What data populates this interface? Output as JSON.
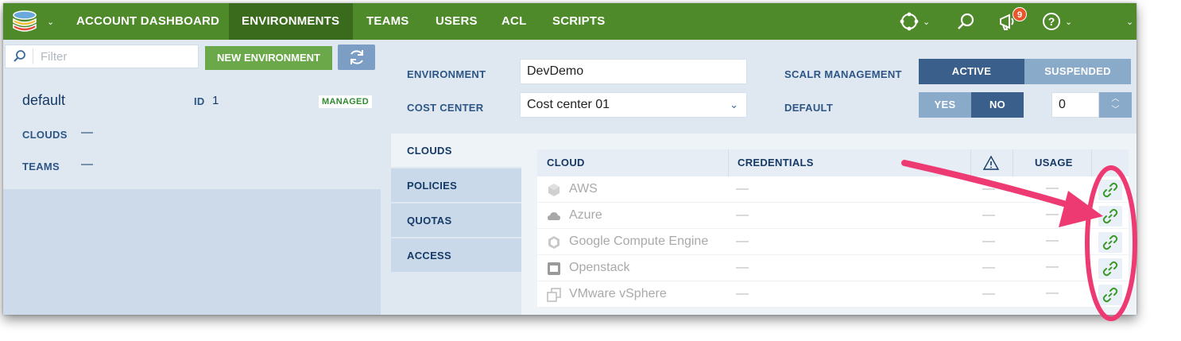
{
  "nav": {
    "items": [
      "ACCOUNT DASHBOARD",
      "ENVIRONMENTS",
      "TEAMS",
      "USERS",
      "ACL",
      "SCRIPTS"
    ],
    "active": "ENVIRONMENTS",
    "notification_count": "9",
    "colors": {
      "bar": "#4e8a2a",
      "active": "#3a6b1c",
      "badge": "#e8562a"
    }
  },
  "sidebar": {
    "filter_placeholder": "Filter",
    "new_button": "NEW ENVIRONMENT",
    "environment": {
      "name": "default",
      "id_label": "ID",
      "id_value": "1",
      "badge": "MANAGED",
      "clouds_label": "CLOUDS",
      "clouds_value": "—",
      "teams_label": "TEAMS",
      "teams_value": "—"
    }
  },
  "form": {
    "environment_label": "ENVIRONMENT",
    "environment_value": "DevDemo",
    "cost_center_label": "COST CENTER",
    "cost_center_value": "Cost center 01",
    "scalr_management_label": "SCALR MANAGEMENT",
    "management_options": [
      "ACTIVE",
      "SUSPENDED"
    ],
    "management_selected": "ACTIVE",
    "default_label": "DEFAULT",
    "default_options": [
      "YES",
      "NO"
    ],
    "default_selected": "NO",
    "default_number": "0"
  },
  "tabs": [
    "CLOUDS",
    "POLICIES",
    "QUOTAS",
    "ACCESS"
  ],
  "active_tab": "CLOUDS",
  "table": {
    "headers": {
      "cloud": "CLOUD",
      "credentials": "CREDENTIALS",
      "usage": "USAGE"
    },
    "rows": [
      {
        "cloud": "AWS",
        "icon": "aws-icon",
        "credentials": "—",
        "warning": "—",
        "usage": "—"
      },
      {
        "cloud": "Azure",
        "icon": "azure-icon",
        "credentials": "—",
        "warning": "—",
        "usage": "—"
      },
      {
        "cloud": "Google Compute Engine",
        "icon": "gce-icon",
        "credentials": "—",
        "warning": "—",
        "usage": "—"
      },
      {
        "cloud": "Openstack",
        "icon": "openstack-icon",
        "credentials": "—",
        "warning": "—",
        "usage": "—"
      },
      {
        "cloud": "VMware vSphere",
        "icon": "vsphere-icon",
        "credentials": "—",
        "warning": "—",
        "usage": "—"
      }
    ]
  },
  "annotation": {
    "color": "#ee3a73"
  }
}
